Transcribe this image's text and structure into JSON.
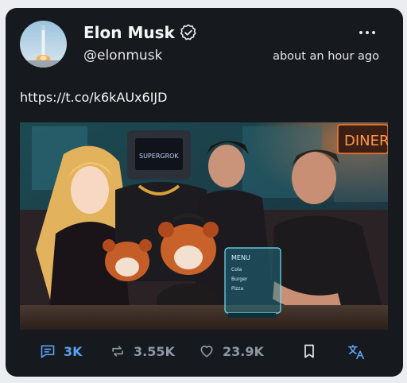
{
  "tweet": {
    "display_name": "Elon Musk",
    "handle": "@elonmusk",
    "timestamp": "about an hour ago",
    "text": "https://t.co/k6kAUx6IJD"
  },
  "media": {
    "headband_text": "SUPERGROK",
    "sign_text": "DINER",
    "menu_title": "MENU",
    "menu_items": [
      "Cola",
      "Burger",
      "Pizza"
    ]
  },
  "actions": {
    "reply_count": "3K",
    "retweet_count": "3.55K",
    "like_count": "23.9K"
  },
  "colors": {
    "card_bg": "#16191e",
    "accent": "#5aa0f0",
    "muted": "#8b98a5"
  },
  "icons": {
    "verified": "verified-badge-icon",
    "more": "more-options-icon",
    "reply": "reply-icon",
    "retweet": "retweet-icon",
    "like": "heart-icon",
    "bookmark": "bookmark-icon",
    "translate": "translate-icon"
  }
}
